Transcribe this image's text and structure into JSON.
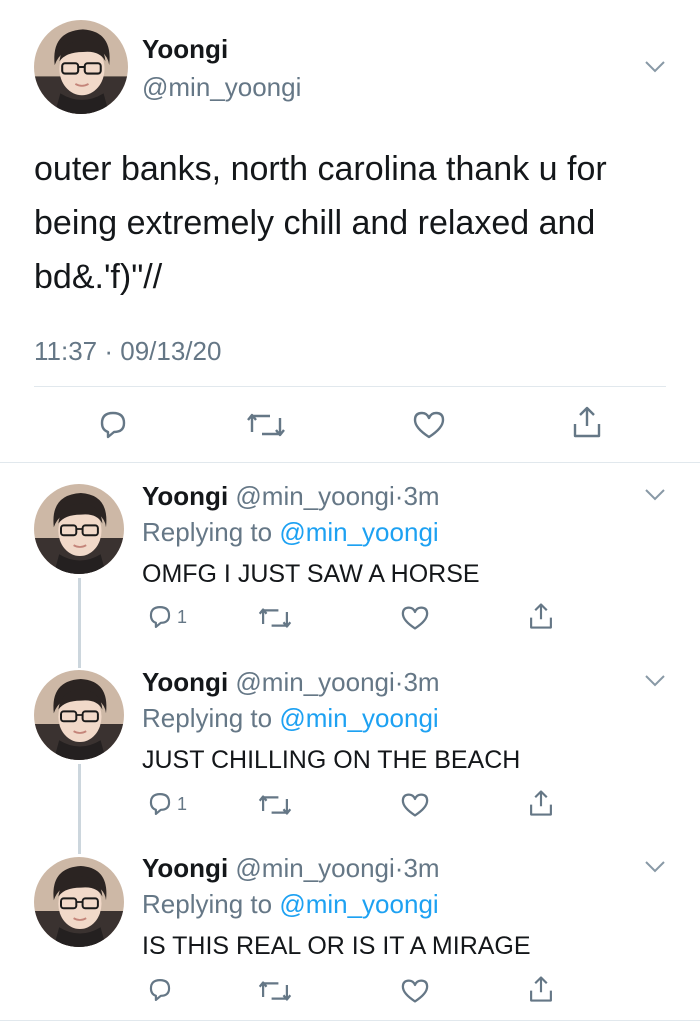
{
  "main_tweet": {
    "name": "Yoongi",
    "handle": "@min_yoongi",
    "text_lines": [
      "outer banks, north carolina thank u for",
      "being extremely chill and relaxed and",
      "bd&.'f)\"//"
    ],
    "timestamp": "11:37 · 09/13/20",
    "icons": {
      "menu": "chevron-down-icon",
      "reply": "reply-icon",
      "retweet": "retweet-icon",
      "like": "heart-icon",
      "share": "share-icon"
    }
  },
  "replies": [
    {
      "name": "Yoongi",
      "handle": "@min_yoongi",
      "dot": "·",
      "time": "3m",
      "replying_prefix": "Replying to",
      "replying_handle": "@min_yoongi",
      "text": "OMFG I JUST SAW A HORSE",
      "reply_count": "1"
    },
    {
      "name": "Yoongi",
      "handle": "@min_yoongi",
      "dot": "·",
      "time": "3m",
      "replying_prefix": "Replying to",
      "replying_handle": "@min_yoongi",
      "text": "JUST CHILLING ON THE BEACH",
      "reply_count": "1"
    },
    {
      "name": "Yoongi",
      "handle": "@min_yoongi",
      "dot": "·",
      "time": "3m",
      "replying_prefix": "Replying to",
      "replying_handle": "@min_yoongi",
      "text": "IS THIS REAL OR IS IT A MIRAGE",
      "reply_count": ""
    }
  ],
  "colors": {
    "text_primary": "#14171a",
    "text_secondary": "#657786",
    "accent": "#1da1f2",
    "divider": "#e1e8ed",
    "thread_line": "#ccd6dd"
  }
}
